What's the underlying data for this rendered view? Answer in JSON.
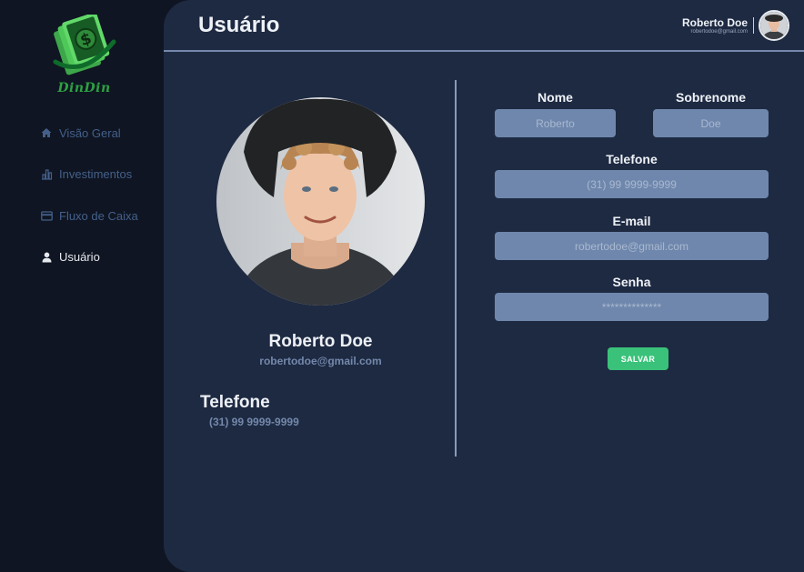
{
  "app": {
    "logo_text": "DinDin"
  },
  "sidebar": {
    "items": [
      {
        "label": "Visão Geral",
        "icon": "home-icon"
      },
      {
        "label": "Investimentos",
        "icon": "bar-chart-icon"
      },
      {
        "label": "Fluxo de Caixa",
        "icon": "credit-card-icon"
      },
      {
        "label": "Usuário",
        "icon": "user-icon",
        "active": true
      }
    ]
  },
  "header": {
    "title": "Usuário",
    "user_name": "Roberto Doe",
    "user_email": "robertodoe@gmail.com"
  },
  "profile": {
    "name": "Roberto Doe",
    "email": "robertodoe@gmail.com",
    "phone_label": "Telefone",
    "phone": "(31) 99 9999-9999"
  },
  "form": {
    "first_name_label": "Nome",
    "first_name_placeholder": "Roberto",
    "last_name_label": "Sobrenome",
    "last_name_placeholder": "Doe",
    "phone_label": "Telefone",
    "phone_placeholder": "(31) 99 9999-9999",
    "email_label": "E-mail",
    "email_placeholder": "robertodoe@gmail.com",
    "password_label": "Senha",
    "password_placeholder": "**************",
    "save_label": "SALVAR"
  },
  "colors": {
    "sidebar_bg": "#0f1522",
    "main_bg": "#1e2a42",
    "input_bg": "#6f87ad",
    "accent_green": "#3ac27a",
    "muted_text": "#7388ab"
  }
}
